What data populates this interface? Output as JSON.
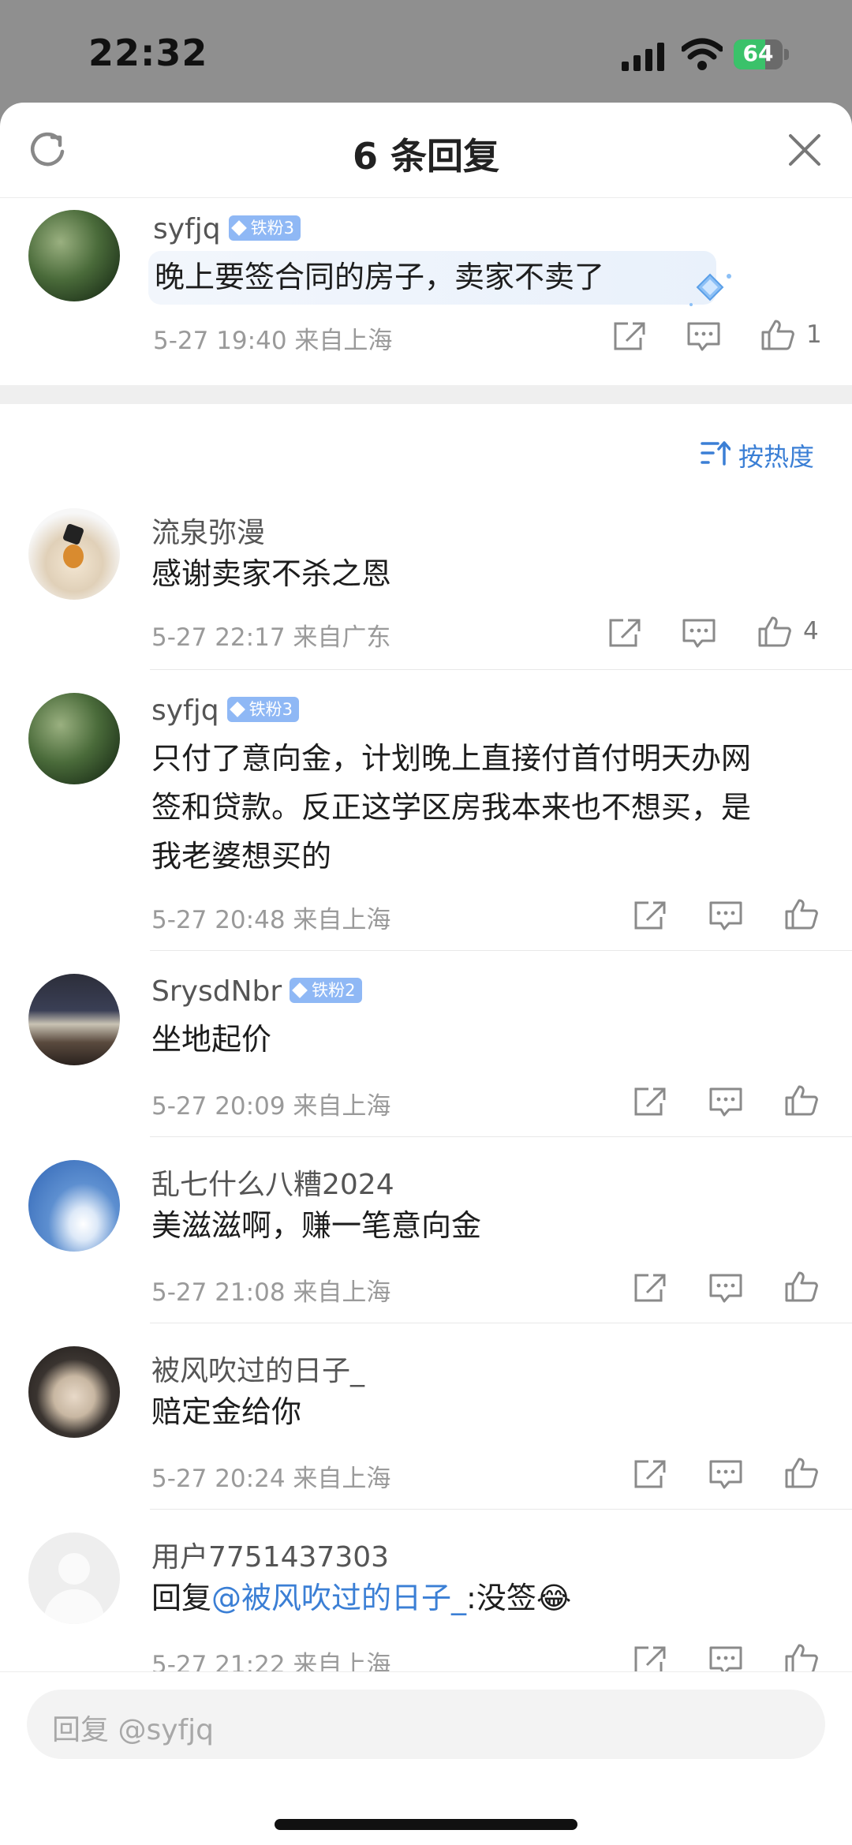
{
  "status_bar": {
    "time": "22:32",
    "battery": "64",
    "battery_level": 0.64
  },
  "sheet": {
    "title": "6 条回复"
  },
  "main_comment": {
    "user": "syfjq",
    "badge": "铁粉3",
    "text": "晚上要签合同的房子，卖家不卖了",
    "meta": "5-27 19:40 来自上海",
    "likes": "1"
  },
  "sort_label": "按热度",
  "replies": [
    {
      "user": "流泉弥漫",
      "badge": "",
      "text_lines": [
        "感谢卖家不杀之恩"
      ],
      "meta": "5-27 22:17 来自广东",
      "likes": "4"
    },
    {
      "user": "syfjq",
      "badge": "铁粉3",
      "text_lines": [
        "只付了意向金，计划晚上直接付首付明天办网",
        "签和贷款。反正这学区房我本来也不想买，是",
        "我老婆想买的"
      ],
      "meta": "5-27 20:48 来自上海",
      "likes": ""
    },
    {
      "user": "SrysdNbr",
      "badge": "铁粉2",
      "text_lines": [
        "坐地起价"
      ],
      "meta": "5-27 20:09 来自上海",
      "likes": ""
    },
    {
      "user": "乱七什么八糟2024",
      "badge": "",
      "text_lines": [
        "美滋滋啊，赚一笔意向金"
      ],
      "meta": "5-27 21:08 来自上海",
      "likes": ""
    },
    {
      "user": "被风吹过的日子_",
      "badge": "",
      "text_lines": [
        "赔定金给你"
      ],
      "meta": "5-27 20:24 来自上海",
      "likes": ""
    },
    {
      "user": "用户7751437303",
      "badge": "",
      "text_prefix": "回复",
      "mention": "@被风吹过的日子_",
      "text_suffix": ":没签",
      "emoji": "😂",
      "meta": "5-27 21:22 来自上海",
      "likes": ""
    }
  ],
  "reply_input": {
    "placeholder": "回复 @syfjq"
  },
  "icons": {
    "refresh": "refresh-icon",
    "close": "close-icon",
    "share": "share-icon",
    "comment": "comment-icon",
    "like": "thumbs-up-icon",
    "sort": "sort-icon",
    "signal": "cellular-signal-icon",
    "wifi": "wifi-icon",
    "battery": "battery-icon"
  },
  "colors": {
    "accent": "#3b7fd5",
    "badge": "#8fb8f5",
    "battery_green": "#3ac26a"
  }
}
